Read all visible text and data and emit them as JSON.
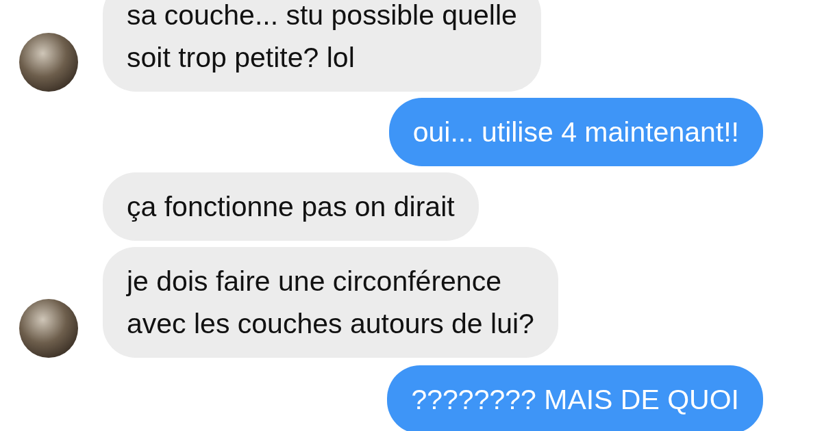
{
  "messages": [
    {
      "kind": "received",
      "avatar": true,
      "lines": [
        "sa couche... stu possible quelle",
        "soit trop petite? lol"
      ]
    },
    {
      "kind": "sent",
      "lines": [
        "oui... utilise 4 maintenant!!"
      ]
    },
    {
      "kind": "received",
      "avatar": false,
      "lines": [
        "ça fonctionne pas on dirait"
      ]
    },
    {
      "kind": "received",
      "avatar": true,
      "lines": [
        "je dois faire une circonférence",
        "avec les couches autours de lui?"
      ]
    },
    {
      "kind": "sent",
      "lines": [
        "???????? MAIS DE QUOI"
      ]
    }
  ]
}
